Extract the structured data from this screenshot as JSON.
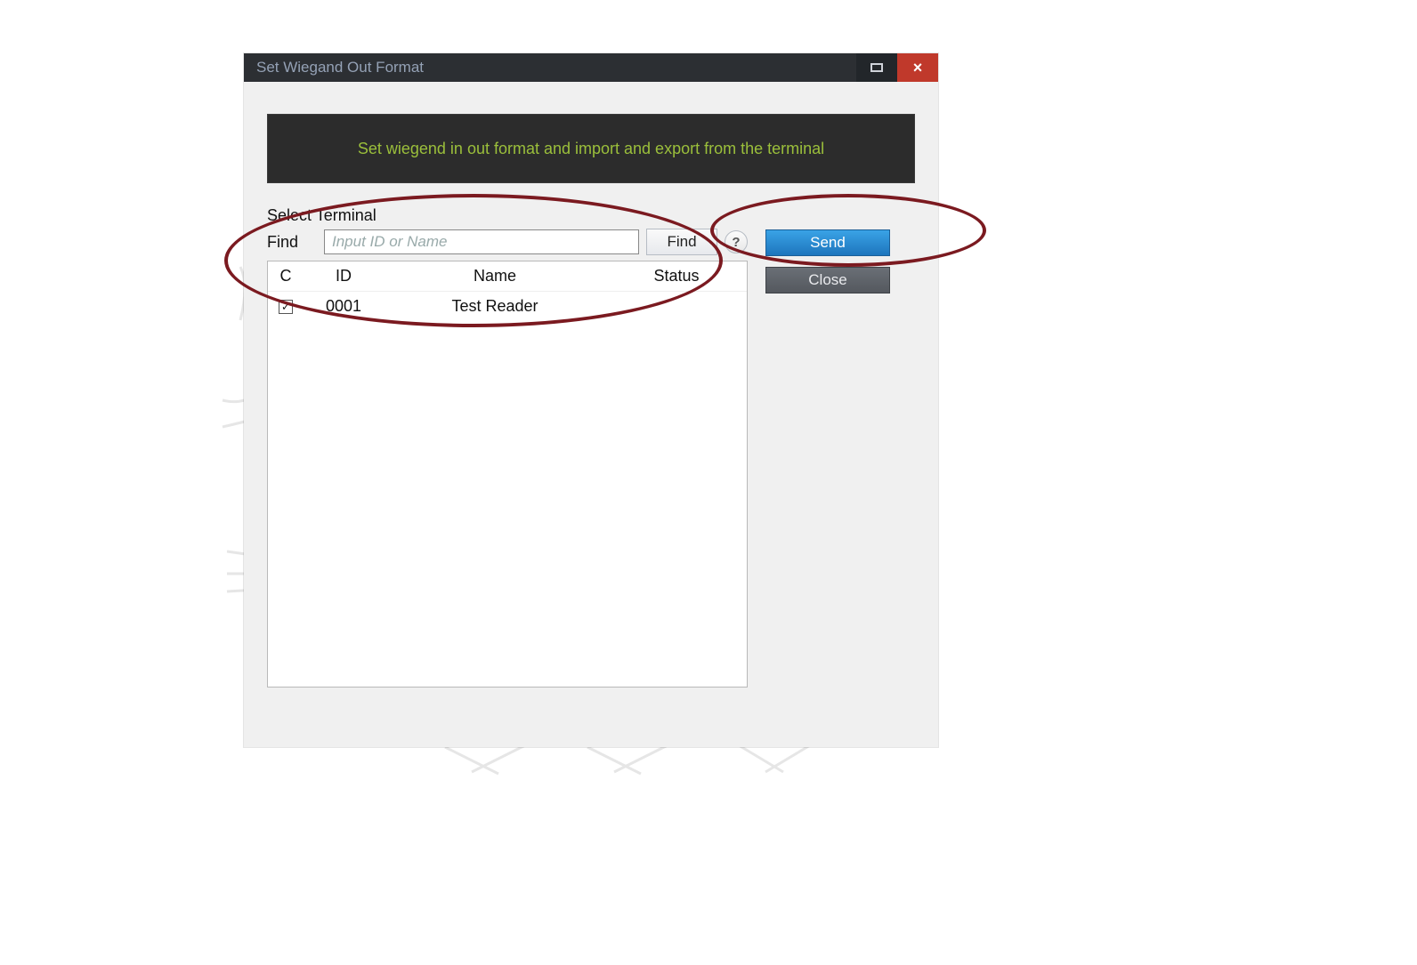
{
  "window": {
    "title": "Set Wiegand Out Format"
  },
  "banner": {
    "text": "Set wiegend in  out format and import and export from the terminal"
  },
  "select_terminal": {
    "section_label": "Select Terminal",
    "find_label": "Find",
    "find_placeholder": "Input ID or Name",
    "find_value": "",
    "find_button": "Find",
    "help_button": "?",
    "columns": {
      "c": "C",
      "id": "ID",
      "name": "Name",
      "status": "Status"
    },
    "rows": [
      {
        "checked": true,
        "id": "0001",
        "name": "Test Reader",
        "status": ""
      }
    ]
  },
  "actions": {
    "send": "Send",
    "close": "Close"
  },
  "icons": {
    "close_glyph": "×",
    "check_glyph": "✓"
  }
}
